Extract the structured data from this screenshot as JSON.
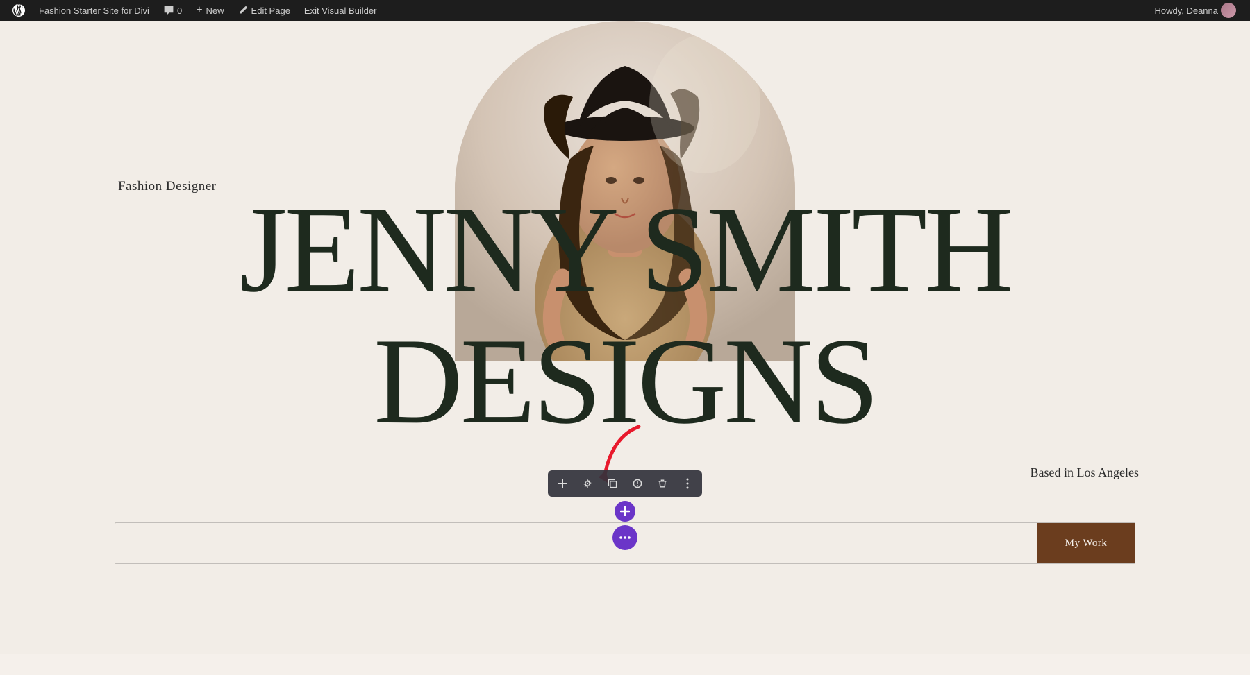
{
  "admin_bar": {
    "site_title": "Fashion Starter Site for Divi",
    "comment_count": "0",
    "new_label": "New",
    "edit_page_label": "Edit Page",
    "exit_vb_label": "Exit Visual Builder",
    "howdy_label": "Howdy, Deanna"
  },
  "hero": {
    "subtitle": "Fashion Designer",
    "title_line1": "JENNY SMITH",
    "title_line2": "DESIGNS",
    "location": "Based in Los Angeles"
  },
  "cta": {
    "my_work_label": "My Work"
  },
  "toolbar": {
    "plus_icon": "+",
    "gear_icon": "⚙",
    "copy_icon": "❐",
    "power_icon": "⏻",
    "trash_icon": "🗑",
    "more_icon": "⋮"
  },
  "colors": {
    "admin_bg": "#1d1d1d",
    "page_bg": "#f2ede7",
    "title_color": "#1e2a1e",
    "cta_btn_bg": "#6b3d1e",
    "toolbar_bg": "rgba(50,50,60,0.92)",
    "purple_btn": "#6b35c8"
  }
}
